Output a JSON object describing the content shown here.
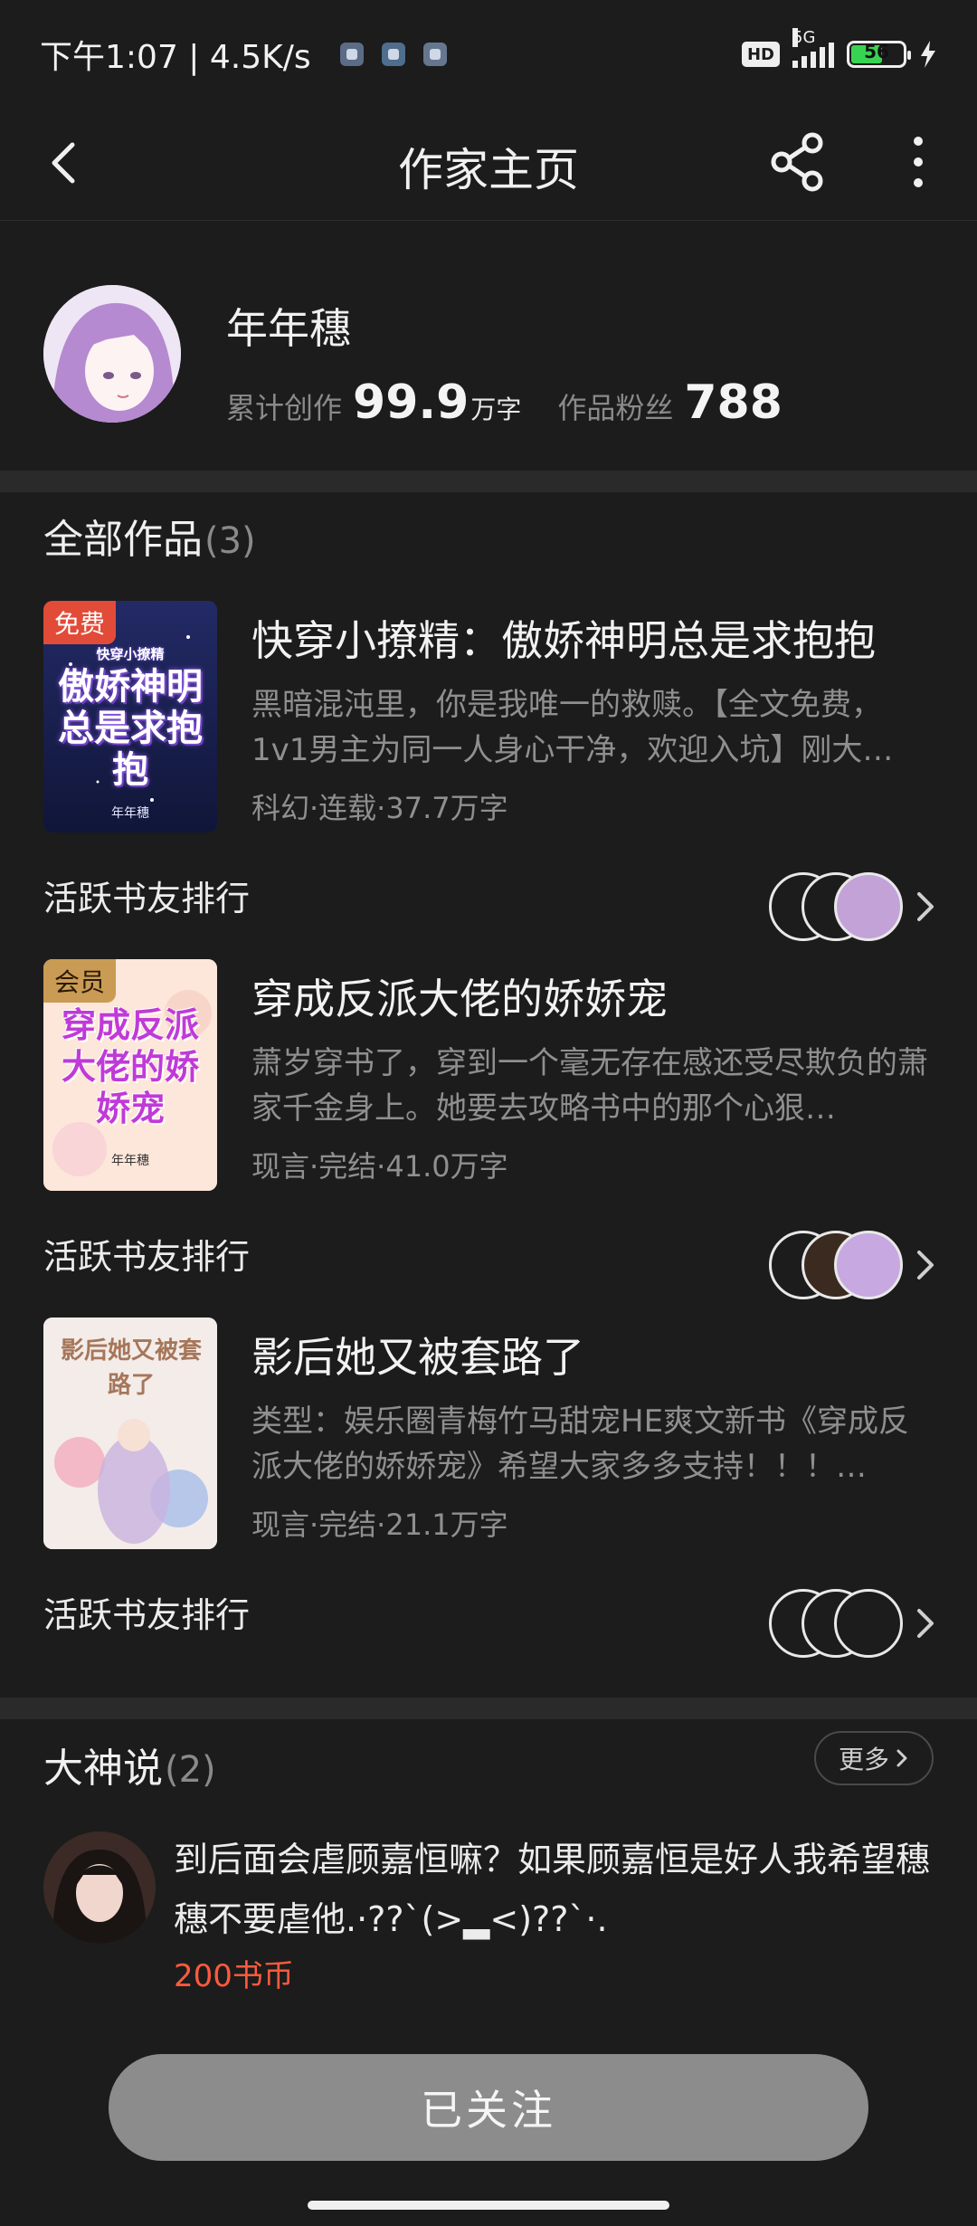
{
  "status_bar": {
    "time_speed": "下午1:07 | 4.5K/s",
    "hd": "HD",
    "network": "5G",
    "battery": "56"
  },
  "nav": {
    "title": "作家主页",
    "back_icon": "chevron-left-icon",
    "share_icon": "share-icon",
    "more_icon": "more-vertical-icon"
  },
  "author": {
    "name": "年年穗",
    "works_label": "累计创作",
    "works_value": "99.9",
    "works_unit": "万字",
    "fans_label": "作品粉丝",
    "fans_value": "788"
  },
  "works": {
    "title": "全部作品",
    "count": "(3)",
    "rank_label": "活跃书友排行",
    "books": [
      {
        "badge": "免费",
        "cover_text": "傲娇神明总是求抱抱",
        "cover_sub": "快穿小撩精",
        "cover_author": "年年穗",
        "title": "快穿小撩精：傲娇神明总是求抱抱",
        "desc": "黑暗混沌里，你是我唯一的救赎。【全文免费，1v1男主为同一人身心干净，欢迎入坑】刚大…",
        "meta": "科幻·连载·37.7万字"
      },
      {
        "badge": "会员",
        "cover_text": "穿成反派大佬的娇娇宠",
        "cover_author": "年年穗",
        "title": "穿成反派大佬的娇娇宠",
        "desc": "萧岁穿书了，穿到一个毫无存在感还受尽欺负的萧家千金身上。她要去攻略书中的那个心狠…",
        "meta": "现言·完结·41.0万字"
      },
      {
        "badge": "",
        "cover_text": "影后她又被套路了",
        "title": "影后她又被套路了",
        "desc": "类型：娱乐圈青梅竹马甜宠HE爽文新书《穿成反派大佬的娇娇宠》希望大家多多支持！！！…",
        "meta": "现言·完结·21.1万字"
      }
    ]
  },
  "dashen": {
    "title": "大神说",
    "count": "(2)",
    "more_label": "更多",
    "comment_text": "到后面会虐顾嘉恒嘛？如果顾嘉恒是好人我希望穗穗不要虐他.·??`(>▂<)??`·.",
    "comment_coin": "200书币"
  },
  "follow_button": "已关注",
  "colors": {
    "background": "#1c1c1c",
    "accent_red": "#ff5a3c",
    "free_badge": "#e24b38",
    "vip_badge": "#c99b54",
    "follow_button": "#8c8c8c"
  }
}
